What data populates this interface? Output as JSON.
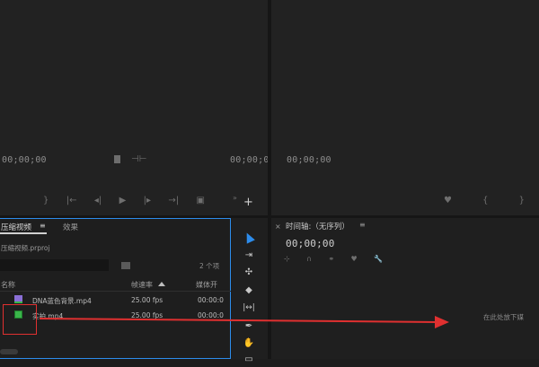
{
  "source_monitor": {
    "timecode_left": "00;00;00",
    "timecode_right": "00;00;0",
    "controls": [
      "}",
      "|←",
      "◂|",
      "▶",
      "|▸",
      "→|",
      "▣"
    ]
  },
  "program_monitor": {
    "timecode": "00;00;00",
    "controls": [
      "♥",
      "{",
      "}"
    ]
  },
  "project_panel": {
    "tab_active": "压缩视频",
    "tab_menu": "≡",
    "tab_inactive": "效果",
    "project_file": "压缩视频.prproj",
    "item_count": "2 个项",
    "columns": {
      "name": "名称",
      "frame_rate": "帧速率",
      "media_start": "媒体开"
    },
    "items": [
      {
        "name": "DNA蓝色背景.mp4",
        "fps": "25.00 fps",
        "start": "00:00:0"
      },
      {
        "name": "实拍.mp4",
        "fps": "25.00 fps",
        "start": "00:00:0"
      }
    ]
  },
  "timeline": {
    "close": "×",
    "title": "时间轴:（无序列）",
    "menu": "≡",
    "timecode": "00;00;00",
    "drop_hint": "在此处放下媒"
  },
  "colors": {
    "accent_blue": "#2d8ceb",
    "annotation_red": "#e03030",
    "clip_green": "#3ab54a",
    "clip_purple": "#8a6fd6"
  }
}
